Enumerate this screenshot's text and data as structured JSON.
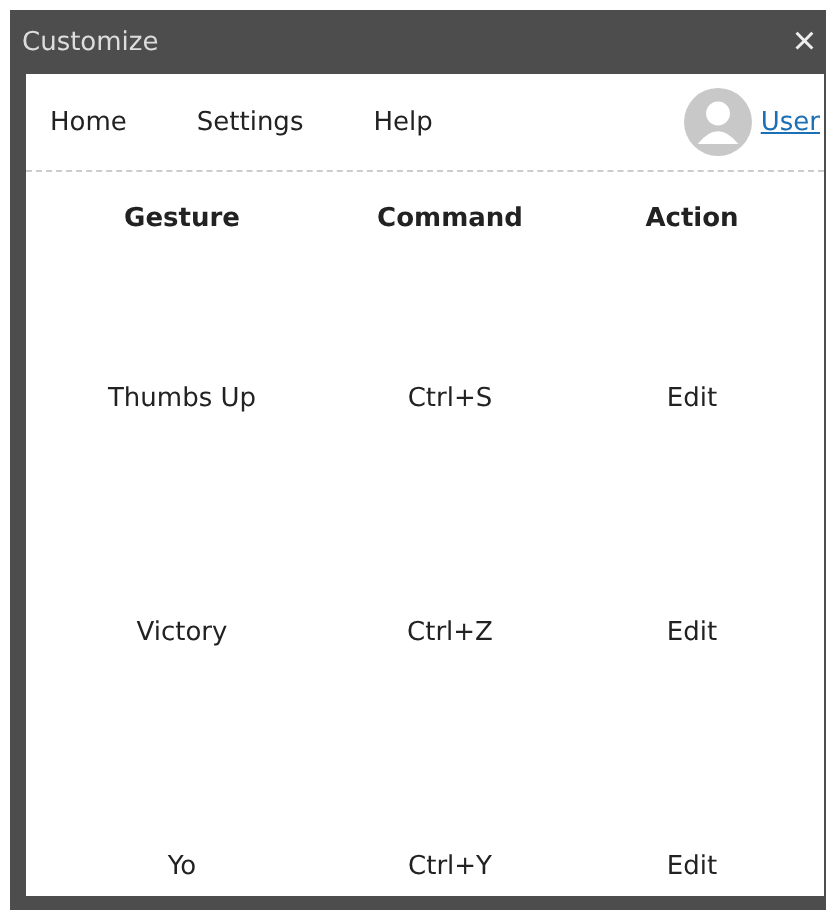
{
  "window": {
    "title": "Customize",
    "close": "×"
  },
  "nav": {
    "items": [
      "Home",
      "Settings",
      "Help"
    ],
    "user": "User"
  },
  "table": {
    "columns": [
      "Gesture",
      "Command",
      "Action"
    ],
    "rows": [
      {
        "gesture": "Thumbs Up",
        "command": "Ctrl+S",
        "action": "Edit"
      },
      {
        "gesture": "Victory",
        "command": "Ctrl+Z",
        "action": "Edit"
      },
      {
        "gesture": "Yo",
        "command": "Ctrl+Y",
        "action": "Edit"
      }
    ]
  }
}
